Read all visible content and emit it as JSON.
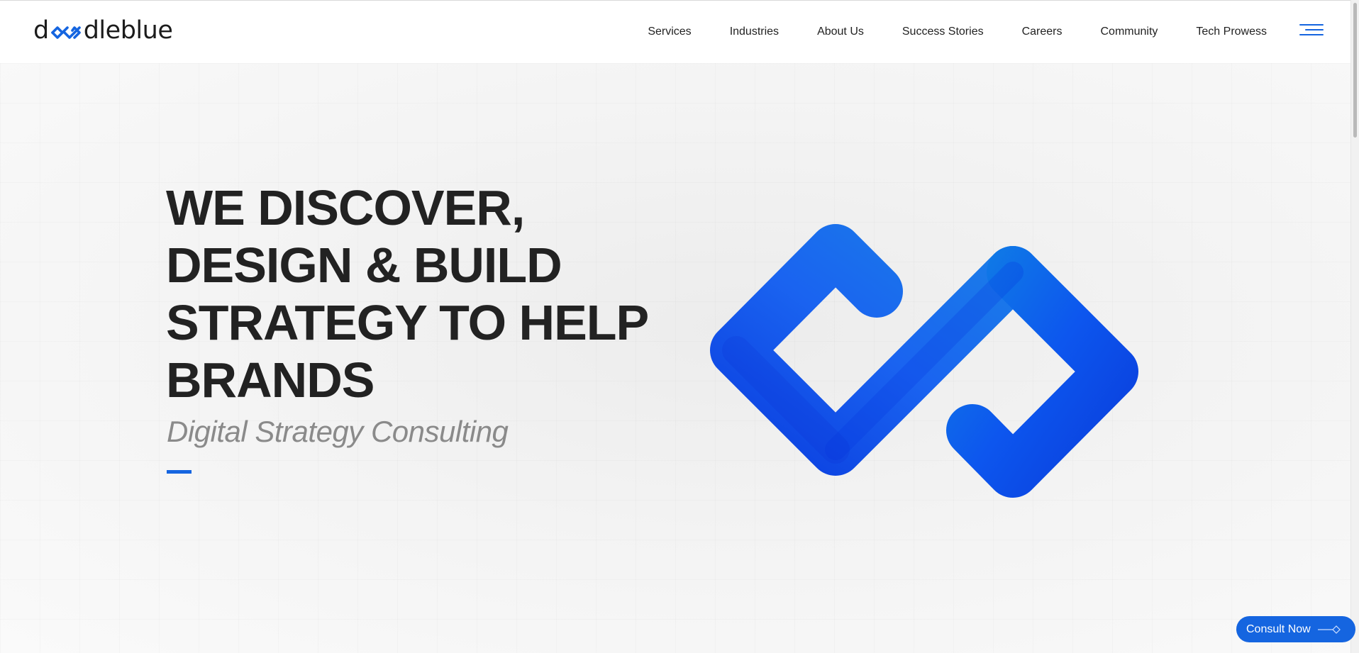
{
  "brand": {
    "logo_text_start": "d",
    "logo_text_end": "dleblue",
    "accent_color": "#1565e0",
    "logo_icon": "infinity-link-icon"
  },
  "nav": {
    "items": [
      {
        "label": "Services"
      },
      {
        "label": "Industries"
      },
      {
        "label": "About Us"
      },
      {
        "label": "Success Stories"
      },
      {
        "label": "Careers"
      },
      {
        "label": "Community"
      },
      {
        "label": "Tech Prowess"
      }
    ],
    "menu_icon": "hamburger-menu-icon"
  },
  "hero": {
    "headline_lines": [
      "WE DISCOVER,",
      "DESIGN & BUILD",
      "STRATEGY TO HELP",
      "BRANDS"
    ],
    "subtitle": "Digital Strategy Consulting",
    "graphic_icon": "infinity-link-icon"
  },
  "cta": {
    "label": "Consult Now",
    "icon": "arrow-right-icon"
  }
}
